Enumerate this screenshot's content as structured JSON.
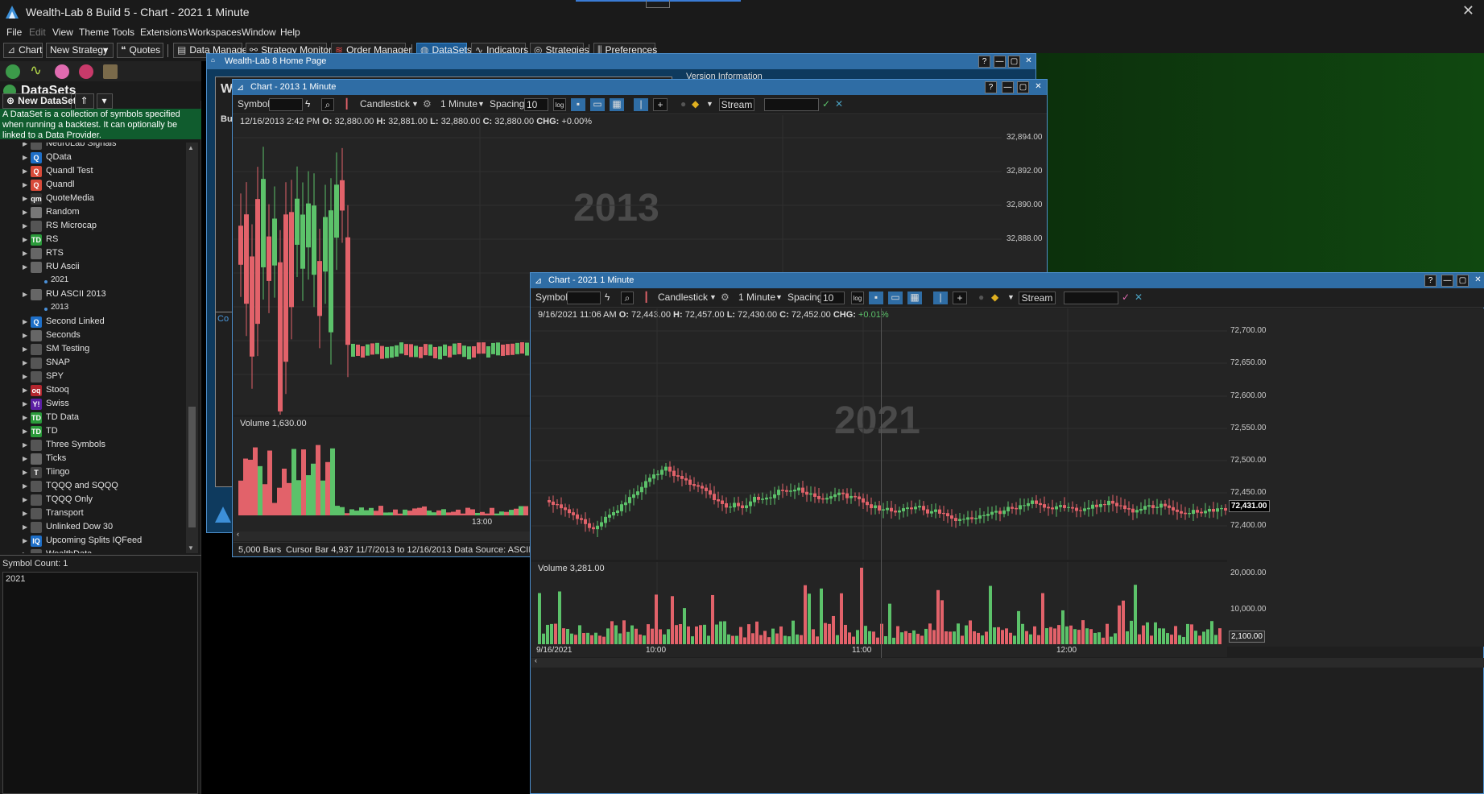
{
  "app": {
    "title": "Wealth-Lab 8 Build 5 - Chart - 2021 1 Minute",
    "close_glyph": "✕"
  },
  "menu": [
    "File",
    "Edit",
    "View",
    "Theme",
    "Tools",
    "Extensions",
    "Workspaces",
    "Window",
    "Help"
  ],
  "toolbar": {
    "chart": "Chart",
    "strategy_select": "New Strategy",
    "quotes": "Quotes",
    "data_manager": "Data Manager",
    "strategy_monitor": "Strategy Monitor",
    "order_manager": "Order Manager",
    "datasets": "DataSets",
    "indicators": "Indicators",
    "strategies": "Strategies",
    "preferences": "Preferences"
  },
  "left_panel": {
    "title": "DataSets",
    "new_dataset": "New DataSet",
    "description": "A DataSet is a collection of symbols specified when running a backtest. It can optionally be linked to a Data Provider.",
    "tree": [
      {
        "label": "NeuroLab Signals",
        "icon": "globe-icon",
        "color": "#555"
      },
      {
        "label": "QData",
        "icon": "q-icon",
        "color": "#1e6fc8",
        "g": "Q"
      },
      {
        "label": "Quandl Test",
        "icon": "quandl-icon",
        "color": "#d84b3a",
        "g": "Q"
      },
      {
        "label": "Quandl",
        "icon": "quandl-icon",
        "color": "#d84b3a",
        "g": "Q"
      },
      {
        "label": "QuoteMedia",
        "icon": "quotemedia-icon",
        "color": "#333",
        "g": "qm"
      },
      {
        "label": "Random",
        "icon": "dice-icon",
        "color": "#777"
      },
      {
        "label": "RS Microcap",
        "icon": "globe-icon",
        "color": "#555"
      },
      {
        "label": "RS",
        "icon": "td-icon",
        "color": "#2a9a3a",
        "g": "TD"
      },
      {
        "label": "RTS",
        "icon": "grid-icon",
        "color": "#666"
      },
      {
        "label": "RU Ascii",
        "icon": "grid-icon",
        "color": "#666"
      },
      {
        "label": "2021",
        "sub": true
      },
      {
        "label": "RU ASCII 2013",
        "icon": "grid-icon",
        "color": "#666"
      },
      {
        "label": "2013",
        "sub": true
      },
      {
        "label": "Second Linked",
        "icon": "q-icon",
        "color": "#1e6fc8",
        "g": "Q"
      },
      {
        "label": "Seconds",
        "icon": "grid-icon",
        "color": "#666"
      },
      {
        "label": "SM Testing",
        "icon": "globe-icon",
        "color": "#555"
      },
      {
        "label": "SNAP",
        "icon": "globe-icon",
        "color": "#555"
      },
      {
        "label": "SPY",
        "icon": "globe-icon",
        "color": "#555"
      },
      {
        "label": "Stooq",
        "icon": "stooq-icon",
        "color": "#b3262e",
        "g": "oq"
      },
      {
        "label": "Swiss",
        "icon": "yahoo-icon",
        "color": "#5b1fa3",
        "g": "Y!"
      },
      {
        "label": "TD Data",
        "icon": "td-icon",
        "color": "#2a9a3a",
        "g": "TD"
      },
      {
        "label": "TD",
        "icon": "td-icon",
        "color": "#2a9a3a",
        "g": "TD"
      },
      {
        "label": "Three Symbols",
        "icon": "globe-icon",
        "color": "#555"
      },
      {
        "label": "Ticks",
        "icon": "grid-icon",
        "color": "#666"
      },
      {
        "label": "Tiingo",
        "icon": "tiingo-icon",
        "color": "#444",
        "g": "T"
      },
      {
        "label": "TQQQ and SQQQ",
        "icon": "globe-icon",
        "color": "#555"
      },
      {
        "label": "TQQQ Only",
        "icon": "globe-icon",
        "color": "#555"
      },
      {
        "label": "Transport",
        "icon": "globe-icon",
        "color": "#555"
      },
      {
        "label": "Unlinked Dow 30",
        "icon": "globe-icon",
        "color": "#555"
      },
      {
        "label": "Upcoming Splits IQFeed",
        "icon": "iq-icon",
        "color": "#1e6fc8",
        "g": "IQ"
      },
      {
        "label": "WealthData",
        "icon": "globe-icon",
        "color": "#555"
      }
    ],
    "symbol_count": "Symbol Count: 1",
    "symbols": "2021"
  },
  "home_window": {
    "title": "Wealth-Lab 8 Home Page",
    "version_info": "Version Information",
    "frag_w": "W",
    "frag_bu": "Bu",
    "frag_co": "Co"
  },
  "chart2013": {
    "title": "Chart - 2013 1 Minute",
    "symbol_label": "Symbol",
    "style": "Candlestick",
    "scale": "1 Minute",
    "spacing_label": "Spacing",
    "spacing": "10",
    "stream": "Stream",
    "ohlc_date": "12/16/2013 2:42 PM",
    "o": "32,880.00",
    "h": "32,881.00",
    "l": "32,880.00",
    "c": "32,880.00",
    "chg": "+0.00%",
    "watermark": "2013",
    "volume_label": "Volume 1,630.00",
    "price_ticks": [
      "32,894.00",
      "32,892.00",
      "32,890.00",
      "32,888.00"
    ],
    "time_tick": "13:00",
    "status_bars": "5,000 Bars",
    "status_cursor": "Cursor Bar 4,937",
    "status_range": "11/7/2013 to 12/16/2013",
    "status_source": "Data Source: ASCII"
  },
  "chart2021": {
    "title": "Chart - 2021 1 Minute",
    "symbol_label": "Symbol",
    "style": "Candlestick",
    "scale": "1 Minute",
    "spacing_label": "Spacing",
    "spacing": "10",
    "stream": "Stream",
    "ohlc_date": "9/16/2021 11:06 AM",
    "o": "72,443.00",
    "h": "72,457.00",
    "l": "72,430.00",
    "c": "72,452.00",
    "chg": "+0.01%",
    "watermark": "2021",
    "volume_label": "Volume 3,281.00",
    "price_ticks": [
      "72,700.00",
      "72,650.00",
      "72,600.00",
      "72,550.00",
      "72,500.00",
      "72,450.00",
      "72,400.00"
    ],
    "last_price": "72,431.00",
    "vol_ticks": [
      "20,000.00",
      "10,000.00"
    ],
    "last_vol": "2,100.00",
    "time_ticks": [
      "9/16/2021",
      "10:00",
      "11:00",
      "12:00"
    ]
  },
  "colors": {
    "up": "#5cc26a",
    "down": "#e2626a",
    "accent": "#2f6da5"
  },
  "chart_data": [
    {
      "type": "candlestick",
      "title": "Chart - 2013 1 Minute",
      "series": [
        {
          "name": "price",
          "ylim": [
            32886.0,
            32895.0
          ]
        },
        {
          "name": "volume"
        }
      ]
    },
    {
      "type": "candlestick",
      "title": "Chart - 2021 1 Minute",
      "series": [
        {
          "name": "price",
          "ylim": [
            72380,
            72720
          ],
          "last": 72431
        },
        {
          "name": "volume",
          "ylim": [
            0,
            22000
          ],
          "last": 2100
        }
      ]
    }
  ]
}
